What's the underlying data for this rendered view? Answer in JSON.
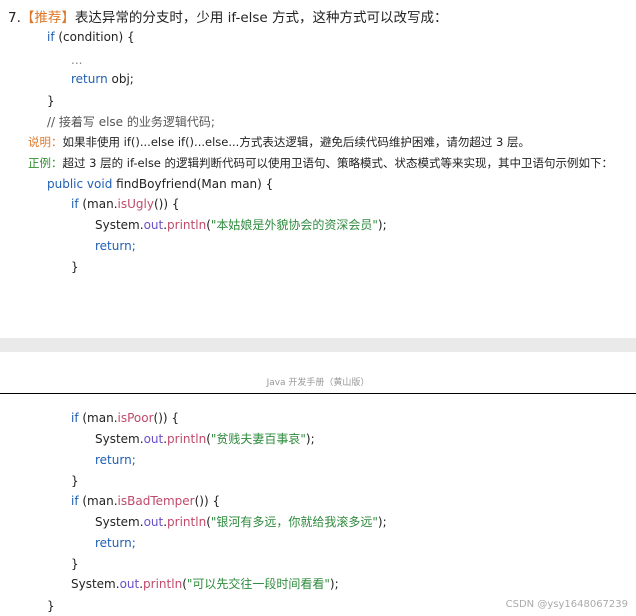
{
  "section": {
    "number": "7.",
    "tag": "【推荐】",
    "title": "表达异常的分支时，少用 if-else 方式，这种方式可以改写成："
  },
  "code1": {
    "l1_kw": "if",
    "l1_rest": " (condition) {",
    "l2": "...",
    "l3_kw": "return",
    "l3_rest": " obj;",
    "l4": "}",
    "l5": "// 接着写 else 的业务逻辑代码;"
  },
  "explain": {
    "label": "说明：",
    "text": "如果非使用 if()...else if()...else...方式表达逻辑，避免后续代码维护困难，请勿超过 3 层。"
  },
  "example": {
    "label": "正例：",
    "text": "超过 3 层的 if-else 的逻辑判断代码可以使用卫语句、策略模式、状态模式等来实现，其中卫语句示例如下："
  },
  "code2": {
    "sig_kw": "public void",
    "sig_name": " findBoyfriend",
    "sig_rest": "(Man man) {",
    "if1_kw": "if",
    "if1_obj": " (man.",
    "if1_method": "isUgly",
    "if1_rest": "()) {",
    "p1_cls": "System.",
    "p1_field": "out",
    "p1_dot": ".",
    "p1_method": "println",
    "p1_open": "(",
    "p1_str": "\"本姑娘是外貌协会的资深会员\"",
    "p1_close": ");",
    "ret1": "return;",
    "close1": "}"
  },
  "footer": {
    "text": "Java 开发手册（黄山版）"
  },
  "code3": {
    "if2_kw": "if",
    "if2_obj": " (man.",
    "if2_method": "isPoor",
    "if2_rest": "()) {",
    "p2_cls": "System.",
    "p2_field": "out",
    "p2_dot": ".",
    "p2_method": "println",
    "p2_open": "(",
    "p2_str": "\"贫贱夫妻百事哀\"",
    "p2_close": ");",
    "ret2": "return;",
    "close2": "}",
    "if3_kw": "if",
    "if3_obj": " (man.",
    "if3_method": "isBadTemper",
    "if3_rest": "()) {",
    "p3_cls": "System.",
    "p3_field": "out",
    "p3_dot": ".",
    "p3_method": "println",
    "p3_open": "(",
    "p3_str": "\"银河有多远，你就给我滚多远\"",
    "p3_close": ");",
    "ret3": "return;",
    "close3": "}",
    "p4_cls": "System.",
    "p4_field": "out",
    "p4_dot": ".",
    "p4_method": "println",
    "p4_open": "(",
    "p4_str": "\"可以先交往一段时间看看\"",
    "p4_close": ");",
    "close4": "}"
  },
  "watermark": "CSDN @ysy1648067239"
}
